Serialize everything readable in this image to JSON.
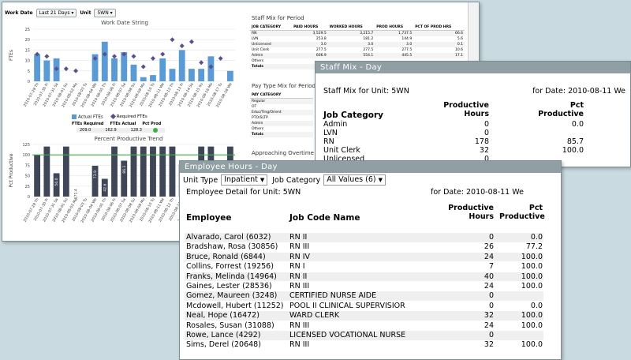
{
  "dashboard": {
    "work_date_label": "Work Date",
    "work_date_value": "Last 21 Days",
    "unit_label": "Unit",
    "unit_value": "5WN",
    "chart1_title": "Work Date String",
    "chart1_ylabel": "FTEs",
    "chart1_yticks": [
      "25",
      "20",
      "15",
      "10",
      "5",
      "0"
    ],
    "legend_actual": "Actual FTEs",
    "legend_required": "Required FTEs",
    "stats_headers": [
      "FTEs Required",
      "FTEs Actual",
      "Pct Prod"
    ],
    "stats_values": [
      "209.0",
      "162.9",
      "128.3"
    ],
    "chart2_title": "Percent Productive Trend",
    "chart2_ylabel": "Pct Productive",
    "chart2_yticks": [
      "125",
      "100",
      "75",
      "50",
      "25",
      "0"
    ],
    "chart2_labels": [
      "",
      "",
      "56.0",
      "",
      "-171.4",
      "",
      "73.9",
      "42.6",
      "",
      "86.1",
      "",
      "",
      "",
      "",
      "",
      "76.6",
      "85.3",
      "",
      "",
      "",
      ""
    ],
    "x_labels": [
      "2010-07-29 Th",
      "2010-07-30 Fr",
      "2010-07-31 Sa",
      "2010-08-01 Su",
      "2010-08-02 Mo",
      "2010-08-03 Tu",
      "2010-08-04 We",
      "2010-08-05 Th",
      "2010-08-06 Fr",
      "2010-08-07 Sa",
      "2010-08-08 Su",
      "2010-08-09 Mo",
      "2010-08-10 Tu",
      "2010-08-11 We",
      "2010-08-12 Th",
      "2010-08-13 Fr",
      "2010-08-14 Sa",
      "2010-08-15 Su",
      "2010-08-16 Mo",
      "2010-08-17 Tu",
      "2010-08-18 We"
    ],
    "staff_mix_title": "Staff Mix for Period",
    "staff_mix_headers": [
      "Job Category",
      "Paid Hours",
      "Worked Hours",
      "Prod Hours",
      "Pct of Prod Hrs"
    ],
    "staff_mix_rows": [
      [
        "RN",
        "3,529.5",
        "3,215.7",
        "1,737.5",
        "66.6"
      ],
      [
        "LVN",
        "253.8",
        "181.2",
        "144.9",
        "5.6"
      ],
      [
        "Unlicensed",
        "3.0",
        "3.0",
        "3.0",
        "0.1"
      ],
      [
        "Unit Clerk",
        "277.5",
        "277.5",
        "277.5",
        "10.6"
      ],
      [
        "Admin",
        "606.9",
        "554.1",
        "445.5",
        "17.1"
      ],
      [
        "Others",
        "",
        "",
        "",
        ""
      ],
      [
        "Totals",
        "",
        "",
        "",
        ""
      ]
    ],
    "pay_type_title": "Pay Type Mix for Period",
    "pay_type_header": "Pay Category",
    "pay_type_rows": [
      "Regular",
      "OT",
      "Educ/Trng/Orient",
      "PTO/SLTP",
      "Admin",
      "Others",
      "Totals"
    ],
    "overtime_label": "Approaching Overtime - T"
  },
  "chart_data": [
    {
      "type": "bar",
      "title": "Work Date String",
      "ylabel": "FTEs",
      "ylim": [
        0,
        25
      ],
      "categories": [
        "2010-07-29 Th",
        "2010-07-30 Fr",
        "2010-07-31 Sa",
        "2010-08-01 Su",
        "2010-08-02 Mo",
        "2010-08-03 Tu",
        "2010-08-04 We",
        "2010-08-05 Th",
        "2010-08-06 Fr",
        "2010-08-07 Sa",
        "2010-08-08 Su",
        "2010-08-09 Mo",
        "2010-08-10 Tu",
        "2010-08-11 We",
        "2010-08-12 Th",
        "2010-08-13 Fr",
        "2010-08-14 Sa",
        "2010-08-15 Su",
        "2010-08-16 Mo",
        "2010-08-17 Tu",
        "2010-08-18 We"
      ],
      "series": [
        {
          "name": "Actual FTEs",
          "values": [
            13,
            10,
            11,
            0,
            0,
            0,
            13,
            19,
            11,
            14,
            8,
            2,
            3,
            11,
            6,
            15,
            6,
            6,
            12,
            0,
            5
          ]
        },
        {
          "name": "Required FTEs",
          "values": [
            13,
            12,
            6,
            6,
            5,
            0,
            11,
            13,
            12,
            13,
            12,
            7,
            11,
            13,
            20,
            17,
            19,
            9,
            7,
            11,
            0
          ]
        }
      ]
    },
    {
      "type": "bar",
      "title": "Percent Productive Trend",
      "ylabel": "Pct Productive",
      "ylim": [
        0,
        125
      ],
      "categories": [
        "2010-07-29 Th",
        "2010-07-30 Fr",
        "2010-07-31 Sa",
        "2010-08-01 Su",
        "2010-08-02 Mo",
        "2010-08-03 Tu",
        "2010-08-04 We",
        "2010-08-05 Th",
        "2010-08-06 Fr",
        "2010-08-07 Sa",
        "2010-08-08 Su",
        "2010-08-09 Mo",
        "2010-08-10 Tu",
        "2010-08-11 We",
        "2010-08-12 Th",
        "2010-08-13 Fr",
        "2010-08-14 Sa",
        "2010-08-15 Su",
        "2010-08-16 Mo",
        "2010-08-17 Tu",
        "2010-08-18 We"
      ],
      "values": [
        100,
        120,
        56,
        120,
        0,
        0,
        73.9,
        42.6,
        120,
        86.1,
        120,
        120,
        120,
        120,
        120,
        76.6,
        85.3,
        120,
        120,
        0,
        120
      ],
      "reference_line": 100
    }
  ],
  "staff_mix_day": {
    "window_title": "Staff Mix - Day",
    "unit_text": "Staff Mix for Unit: 5WN",
    "date_text": "for Date: 2010-08-11 We",
    "col_category": "Job Category",
    "col_hours": "Productive Hours",
    "col_pct": "Pct Productive",
    "rows": [
      [
        "Admin",
        "0",
        "0.0"
      ],
      [
        "LVN",
        "0",
        ""
      ],
      [
        "RN",
        "178",
        "85.7"
      ],
      [
        "Unit Clerk",
        "32",
        "100.0"
      ],
      [
        "Unlicensed",
        "0",
        ""
      ]
    ]
  },
  "employee_hours": {
    "window_title": "Employee Hours - Day",
    "unit_type_label": "Unit Type",
    "unit_type_value": "Inpatient",
    "job_category_label": "Job Category",
    "job_category_value": "All Values (6)",
    "unit_text": "Employee Detail for Unit: 5WN",
    "date_text": "for Date: 2010-08-11 We",
    "col_employee": "Employee",
    "col_job": "Job Code Name",
    "col_hours": "Productive Hours",
    "col_pct": "Pct Productive",
    "rows": [
      [
        "Alvarado, Carol (6032)",
        "RN II",
        "0",
        "0.0"
      ],
      [
        "Bradshaw, Rosa (30856)",
        "RN III",
        "26",
        "77.2"
      ],
      [
        "Bruce, Ronald (6844)",
        "RN IV",
        "24",
        "100.0"
      ],
      [
        "Collins, Forrest (19256)",
        "RN I",
        "7",
        "100.0"
      ],
      [
        "Franks, Melinda (14964)",
        "RN II",
        "40",
        "100.0"
      ],
      [
        "Gaines, Lester (28536)",
        "RN III",
        "24",
        "100.0"
      ],
      [
        "Gomez, Maureen (3248)",
        "CERTIFIED NURSE AIDE",
        "0",
        ""
      ],
      [
        "Mcdowell, Hubert (11252)",
        "POOL II CLINICAL SUPERVISIOR",
        "0",
        "0.0"
      ],
      [
        "Neal, Hope (16472)",
        "WARD CLERK",
        "32",
        "100.0"
      ],
      [
        "Rosales, Susan (31088)",
        "RN III",
        "24",
        "100.0"
      ],
      [
        "Rowe, Lance (4292)",
        "LICENSED VOCATIONAL NURSE",
        "0",
        ""
      ],
      [
        "Sims, Derel (20648)",
        "RN III",
        "32",
        "100.0"
      ]
    ]
  }
}
